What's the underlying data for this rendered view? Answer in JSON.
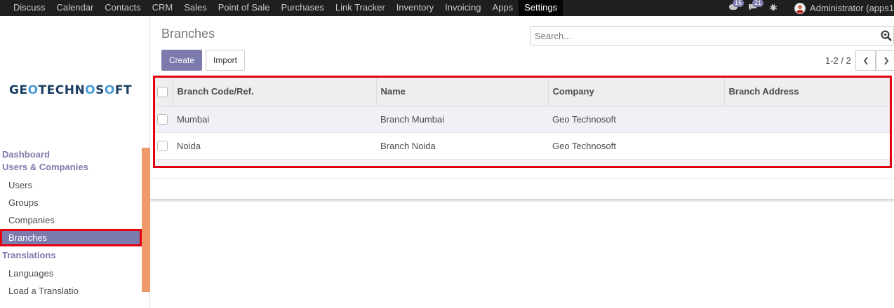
{
  "topbar": {
    "menu": [
      "Discuss",
      "Calendar",
      "Contacts",
      "CRM",
      "Sales",
      "Point of Sale",
      "Purchases",
      "Link Tracker",
      "Inventory",
      "Invoicing",
      "Apps",
      "Settings"
    ],
    "active": "Settings",
    "messages_badge": "15",
    "chat_badge": "21",
    "user": "Administrator (apps1"
  },
  "logo": {
    "text": "GEOTECHNOSOFT"
  },
  "sidebar": {
    "dashboard": "Dashboard",
    "users_companies": "Users & Companies",
    "users": "Users",
    "groups": "Groups",
    "companies": "Companies",
    "branches": "Branches",
    "translations": "Translations",
    "languages": "Languages",
    "partial": "Load a Translatio"
  },
  "control": {
    "title": "Branches",
    "search_placeholder": "Search...",
    "create": "Create",
    "import": "Import",
    "pager": "1-2 / 2"
  },
  "list": {
    "columns": [
      "Branch Code/Ref.",
      "Name",
      "Company",
      "Branch Address"
    ],
    "rows": [
      {
        "code": "Mumbai",
        "name": "Branch Mumbai",
        "company": "Geo Technosoft",
        "address": ""
      },
      {
        "code": "Noida",
        "name": "Branch Noida",
        "company": "Geo Technosoft",
        "address": ""
      }
    ]
  },
  "colors": {
    "accent": "#7c7bad",
    "highlight": "#e3000f",
    "topbar": "#1f1f1f"
  }
}
